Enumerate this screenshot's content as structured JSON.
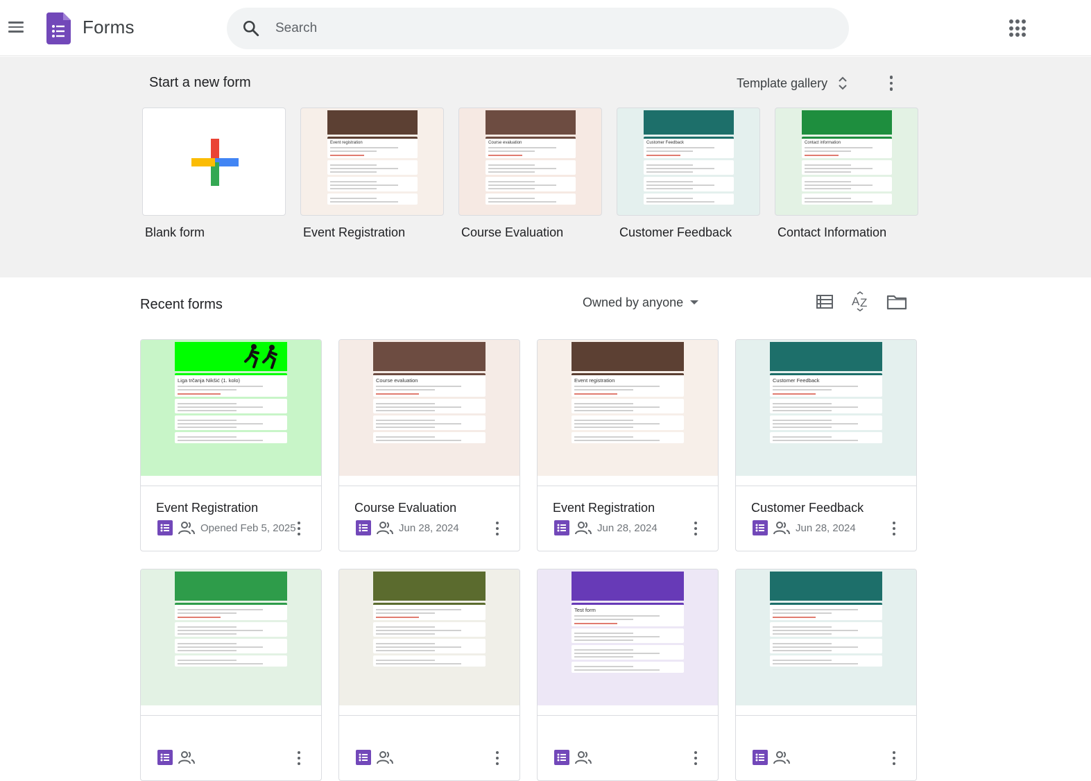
{
  "header": {
    "app_title": "Forms",
    "search_placeholder": "Search"
  },
  "templates": {
    "section_title": "Start a new form",
    "gallery_label": "Template gallery",
    "items": [
      {
        "label": "Blank form"
      },
      {
        "label": "Event Registration",
        "preview_title": "Event registration",
        "accent": "#5c4033",
        "bg": "#f7efe9"
      },
      {
        "label": "Course Evaluation",
        "preview_title": "Course evaluation",
        "accent": "#6d4c41",
        "bg": "#f6e9e3"
      },
      {
        "label": "Customer Feedback",
        "preview_title": "Customer Feedback",
        "accent": "#1d6f6a",
        "bg": "#e4f0ee"
      },
      {
        "label": "Contact Information",
        "preview_title": "Contact information",
        "accent": "#1e8e3e",
        "bg": "#e3f2e4"
      }
    ]
  },
  "recent": {
    "section_title": "Recent forms",
    "owner_filter": "Owned by anyone",
    "forms": [
      {
        "title": "Event Registration",
        "date": "Opened Feb 5, 2025",
        "preview_title": "Liga trčanja Nikšić (1. kolo)",
        "accent": "#00ff00",
        "bg": "#c8f5c8"
      },
      {
        "title": "Course Evaluation",
        "date": "Jun 28, 2024",
        "preview_title": "Course evaluation",
        "accent": "#6d4c41",
        "bg": "#f5ebe6"
      },
      {
        "title": "Event Registration",
        "date": "Jun 28, 2024",
        "preview_title": "Event registration",
        "accent": "#5c4033",
        "bg": "#f7efe9"
      },
      {
        "title": "Customer Feedback",
        "date": "Jun 28, 2024",
        "preview_title": "Customer Feedback",
        "accent": "#1d6f6a",
        "bg": "#e4f0ee"
      },
      {
        "title": "",
        "date": "",
        "preview_title": "",
        "accent": "#2e9c4a",
        "bg": "#e3f2e4"
      },
      {
        "title": "",
        "date": "",
        "preview_title": "",
        "accent": "#5b6b2e",
        "bg": "#f0efe8"
      },
      {
        "title": "",
        "date": "",
        "preview_title": "Test form",
        "accent": "#673ab7",
        "bg": "#ede7f6"
      },
      {
        "title": "",
        "date": "",
        "preview_title": "",
        "accent": "#1d6f6a",
        "bg": "#e4f0ee"
      }
    ]
  },
  "colors": {
    "forms_purple": "#7248b9",
    "plus_red": "#ea4335",
    "plus_blue": "#4285f4",
    "plus_yellow": "#fbbc04",
    "plus_green": "#34a853"
  }
}
